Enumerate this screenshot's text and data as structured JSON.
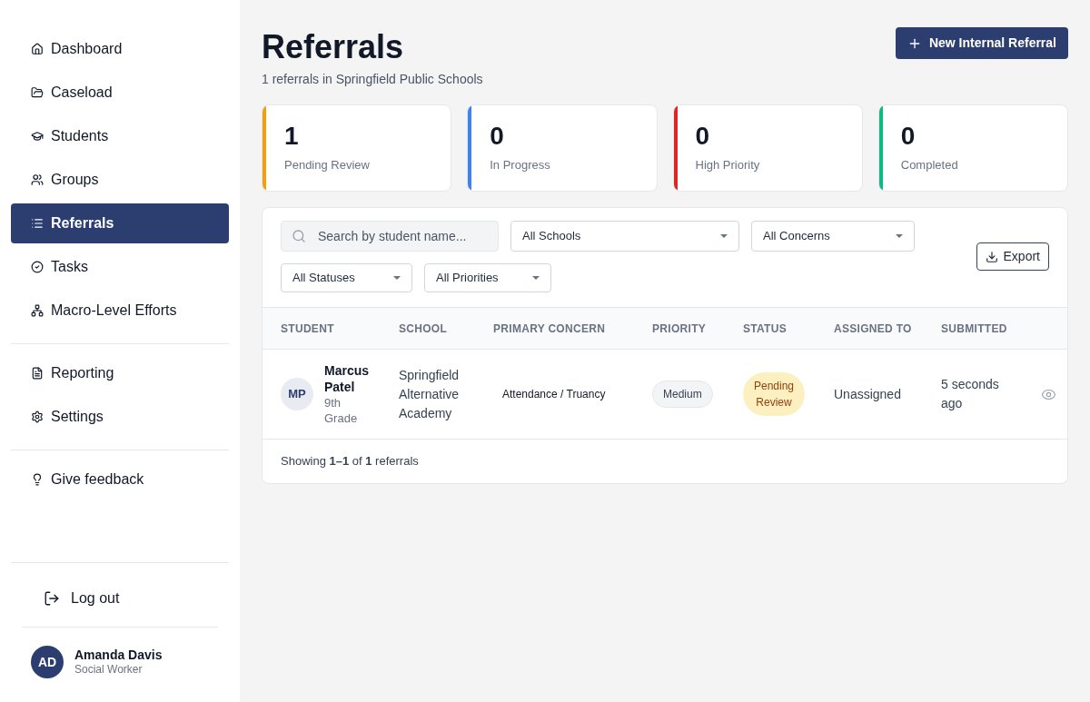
{
  "sidebar": {
    "sections": [
      {
        "items": [
          {
            "label": "Dashboard",
            "selected": false
          },
          {
            "label": "Caseload",
            "selected": false
          },
          {
            "label": "Students",
            "selected": false
          },
          {
            "label": "Groups",
            "selected": false
          },
          {
            "label": "Referrals",
            "selected": true
          },
          {
            "label": "Tasks",
            "selected": false
          },
          {
            "label": "Macro-Level Efforts",
            "selected": false
          }
        ]
      },
      {
        "items": [
          {
            "label": "Reporting",
            "selected": false
          },
          {
            "label": "Settings",
            "selected": false
          }
        ]
      },
      {
        "items": [
          {
            "label": "Give feedback",
            "selected": false
          }
        ]
      }
    ],
    "logout": "Log out",
    "user": {
      "initials": "AD",
      "name": "Amanda Davis",
      "role": "Social Worker"
    }
  },
  "header": {
    "title": "Referrals",
    "subtitle": "1 referrals in Springfield Public Schools",
    "new_button": "New Internal Referral"
  },
  "stats": [
    {
      "value": "1",
      "label": "Pending Review",
      "color": "#f59e0b"
    },
    {
      "value": "0",
      "label": "In Progress",
      "color": "#3b82f6"
    },
    {
      "value": "0",
      "label": "High Priority",
      "color": "#dc2626"
    },
    {
      "value": "0",
      "label": "Completed",
      "color": "#10b981"
    }
  ],
  "filters": {
    "search": {
      "placeholder": "Search by student name..."
    },
    "selects": [
      {
        "value": "All Schools"
      },
      {
        "value": "All Concerns"
      },
      {
        "value": "All Statuses"
      },
      {
        "value": "All Priorities"
      }
    ],
    "export": "Export"
  },
  "table": {
    "columns": [
      "STUDENT",
      "SCHOOL",
      "PRIMARY CONCERN",
      "PRIORITY",
      "STATUS",
      "ASSIGNED TO",
      "SUBMITTED"
    ],
    "rows": [
      {
        "student": {
          "initials": "MP",
          "name": "Marcus Patel",
          "grade": "9th Grade"
        },
        "school": "Springfield Alternative Academy",
        "concern": "Attendance / Truancy",
        "priority": "Medium",
        "status": "Pending Review",
        "assigned_to": "Unassigned",
        "submitted": "5 seconds ago"
      }
    ],
    "footer": "Showing **1–1** of **1** referrals"
  }
}
